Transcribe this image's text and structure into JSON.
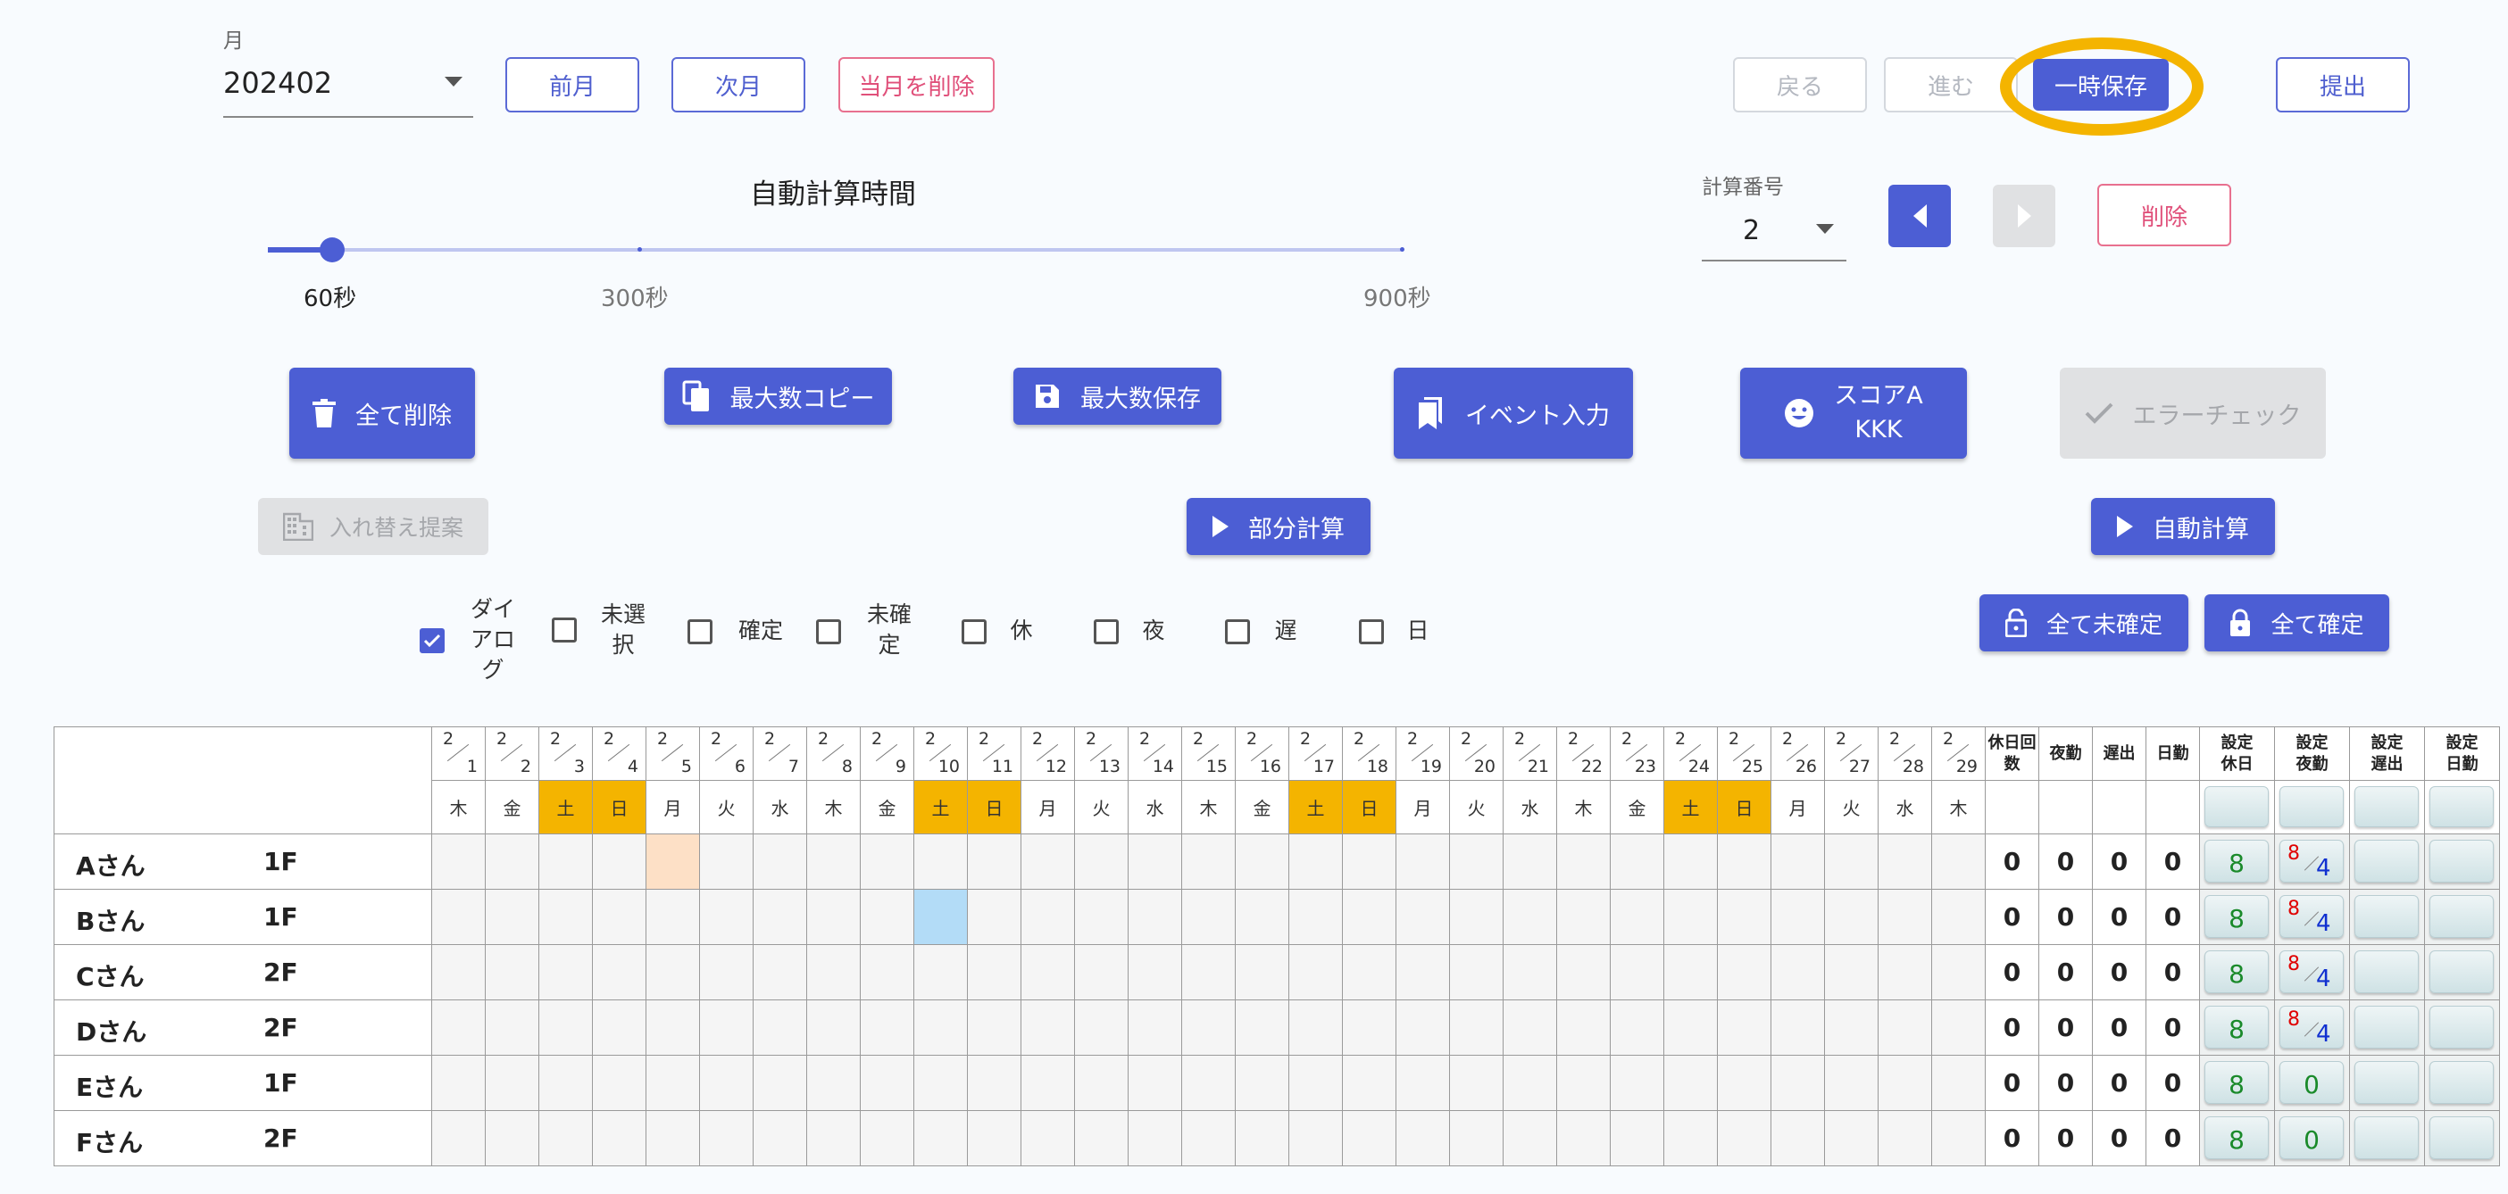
{
  "month": {
    "label": "月",
    "value": "202402"
  },
  "nav": {
    "prev_month": "前月",
    "next_month": "次月",
    "delete_month": "当月を削除"
  },
  "top_actions": {
    "back": "戻る",
    "forward": "進む",
    "temp_save": "一時保存",
    "submit": "提出"
  },
  "slider": {
    "title": "自動計算時間",
    "value_seconds": 60,
    "marks": [
      "60秒",
      "300秒",
      "900秒"
    ]
  },
  "calc_number": {
    "label": "計算番号",
    "value": "2",
    "delete": "削除"
  },
  "buttons": {
    "delete_all": "全て削除",
    "copy_max": "最大数コピー",
    "save_max": "最大数保存",
    "event_input": "イベント入力",
    "score_line1": "スコアA",
    "score_line2": "KKK",
    "error_check": "エラーチェック",
    "swap_suggest": "入れ替え提案",
    "partial_calc": "部分計算",
    "auto_calc": "自動計算",
    "all_unconfirm": "全て未確定",
    "all_confirm": "全て確定"
  },
  "filters": [
    {
      "label": "ダイ\nアロ\nグ",
      "checked": true
    },
    {
      "label": "未選\n択",
      "checked": false
    },
    {
      "label": "確定",
      "checked": false
    },
    {
      "label": "未確\n定",
      "checked": false
    },
    {
      "label": "休",
      "checked": false
    },
    {
      "label": "夜",
      "checked": false
    },
    {
      "label": "遅",
      "checked": false
    },
    {
      "label": "日",
      "checked": false
    }
  ],
  "table": {
    "month_num": "2",
    "days": [
      "1",
      "2",
      "3",
      "4",
      "5",
      "6",
      "7",
      "8",
      "9",
      "10",
      "11",
      "12",
      "13",
      "14",
      "15",
      "16",
      "17",
      "18",
      "19",
      "20",
      "21",
      "22",
      "23",
      "24",
      "25",
      "26",
      "27",
      "28",
      "29"
    ],
    "weekdays": [
      "木",
      "金",
      "土",
      "日",
      "月",
      "火",
      "水",
      "木",
      "金",
      "土",
      "日",
      "月",
      "火",
      "水",
      "木",
      "金",
      "土",
      "日",
      "月",
      "火",
      "水",
      "木",
      "金",
      "土",
      "日",
      "月",
      "火",
      "水",
      "木"
    ],
    "summary_headers": [
      "休日回\n数",
      "夜勤",
      "遅出",
      "日勤"
    ],
    "setting_headers": [
      "設定\n休日",
      "設定\n夜勤",
      "設定\n遅出",
      "設定\n日勤"
    ],
    "rows": [
      {
        "name": "Aさん",
        "floor": "1F",
        "sums": [
          "0",
          "0",
          "0",
          "0"
        ],
        "set_holiday": "8",
        "set_night_a": "8",
        "set_night_b": "4",
        "set_night_zero": ""
      },
      {
        "name": "Bさん",
        "floor": "1F",
        "sums": [
          "0",
          "0",
          "0",
          "0"
        ],
        "set_holiday": "8",
        "set_night_a": "8",
        "set_night_b": "4",
        "set_night_zero": ""
      },
      {
        "name": "Cさん",
        "floor": "2F",
        "sums": [
          "0",
          "0",
          "0",
          "0"
        ],
        "set_holiday": "8",
        "set_night_a": "8",
        "set_night_b": "4",
        "set_night_zero": ""
      },
      {
        "name": "Dさん",
        "floor": "2F",
        "sums": [
          "0",
          "0",
          "0",
          "0"
        ],
        "set_holiday": "8",
        "set_night_a": "8",
        "set_night_b": "4",
        "set_night_zero": ""
      },
      {
        "name": "Eさん",
        "floor": "1F",
        "sums": [
          "0",
          "0",
          "0",
          "0"
        ],
        "set_holiday": "8",
        "set_night_a": "",
        "set_night_b": "",
        "set_night_zero": "0"
      },
      {
        "name": "Fさん",
        "floor": "2F",
        "sums": [
          "0",
          "0",
          "0",
          "0"
        ],
        "set_holiday": "8",
        "set_night_a": "",
        "set_night_b": "",
        "set_night_zero": "0"
      }
    ],
    "highlights": [
      {
        "row": 0,
        "day": 5,
        "color": "#fde0c6"
      },
      {
        "row": 1,
        "day": 10,
        "color": "#b3dcf7"
      }
    ]
  },
  "colors": {
    "primary": "#4c5ed4",
    "weekend": "#f4b400",
    "highlight_ring": "#f4b400",
    "danger": "#e0507a"
  }
}
